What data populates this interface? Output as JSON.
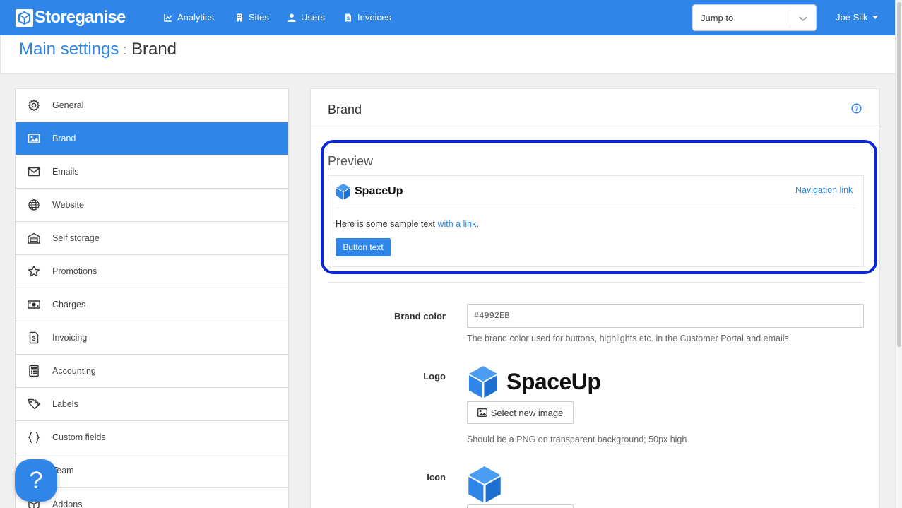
{
  "app": {
    "name": "Storeganise"
  },
  "nav": {
    "items": [
      {
        "label": "Analytics",
        "icon": "chart-icon"
      },
      {
        "label": "Sites",
        "icon": "building-icon"
      },
      {
        "label": "Users",
        "icon": "user-icon"
      },
      {
        "label": "Invoices",
        "icon": "invoice-icon"
      }
    ],
    "jump_placeholder": "Jump to",
    "user": "Joe Silk"
  },
  "breadcrumb": {
    "parent": "Main settings",
    "separator": ":",
    "current": "Brand"
  },
  "sidebar": {
    "items": [
      {
        "label": "General",
        "icon": "gear-icon"
      },
      {
        "label": "Brand",
        "icon": "image-icon",
        "active": true
      },
      {
        "label": "Emails",
        "icon": "envelope-icon"
      },
      {
        "label": "Website",
        "icon": "globe-icon"
      },
      {
        "label": "Self storage",
        "icon": "warehouse-icon"
      },
      {
        "label": "Promotions",
        "icon": "star-icon"
      },
      {
        "label": "Charges",
        "icon": "money-icon"
      },
      {
        "label": "Invoicing",
        "icon": "invoice-icon"
      },
      {
        "label": "Accounting",
        "icon": "calculator-icon"
      },
      {
        "label": "Labels",
        "icon": "tags-icon"
      },
      {
        "label": "Custom fields",
        "icon": "braces-icon"
      },
      {
        "label": "Team",
        "icon": "team-icon"
      },
      {
        "label": "Addons",
        "icon": "cube-icon"
      }
    ]
  },
  "panel": {
    "title": "Brand",
    "preview": {
      "title": "Preview",
      "logo_text": "SpaceUp",
      "nav_link": "Navigation link",
      "sample_text": "Here is some sample text ",
      "sample_link": "with a link",
      "sample_end": ".",
      "button_text": "Button text"
    },
    "brand_color": {
      "label": "Brand color",
      "value": "#4992EB",
      "help": "The brand color used for buttons, highlights etc. in the Customer Portal and emails."
    },
    "logo": {
      "label": "Logo",
      "logo_text": "SpaceUp",
      "button": "Select new image",
      "help": "Should be a PNG on transparent background; 50px high"
    },
    "icon": {
      "label": "Icon"
    }
  },
  "colors": {
    "primary": "#2f86e8",
    "highlight_outline": "#0b27d8"
  },
  "floating_help": {
    "glyph": "?"
  }
}
